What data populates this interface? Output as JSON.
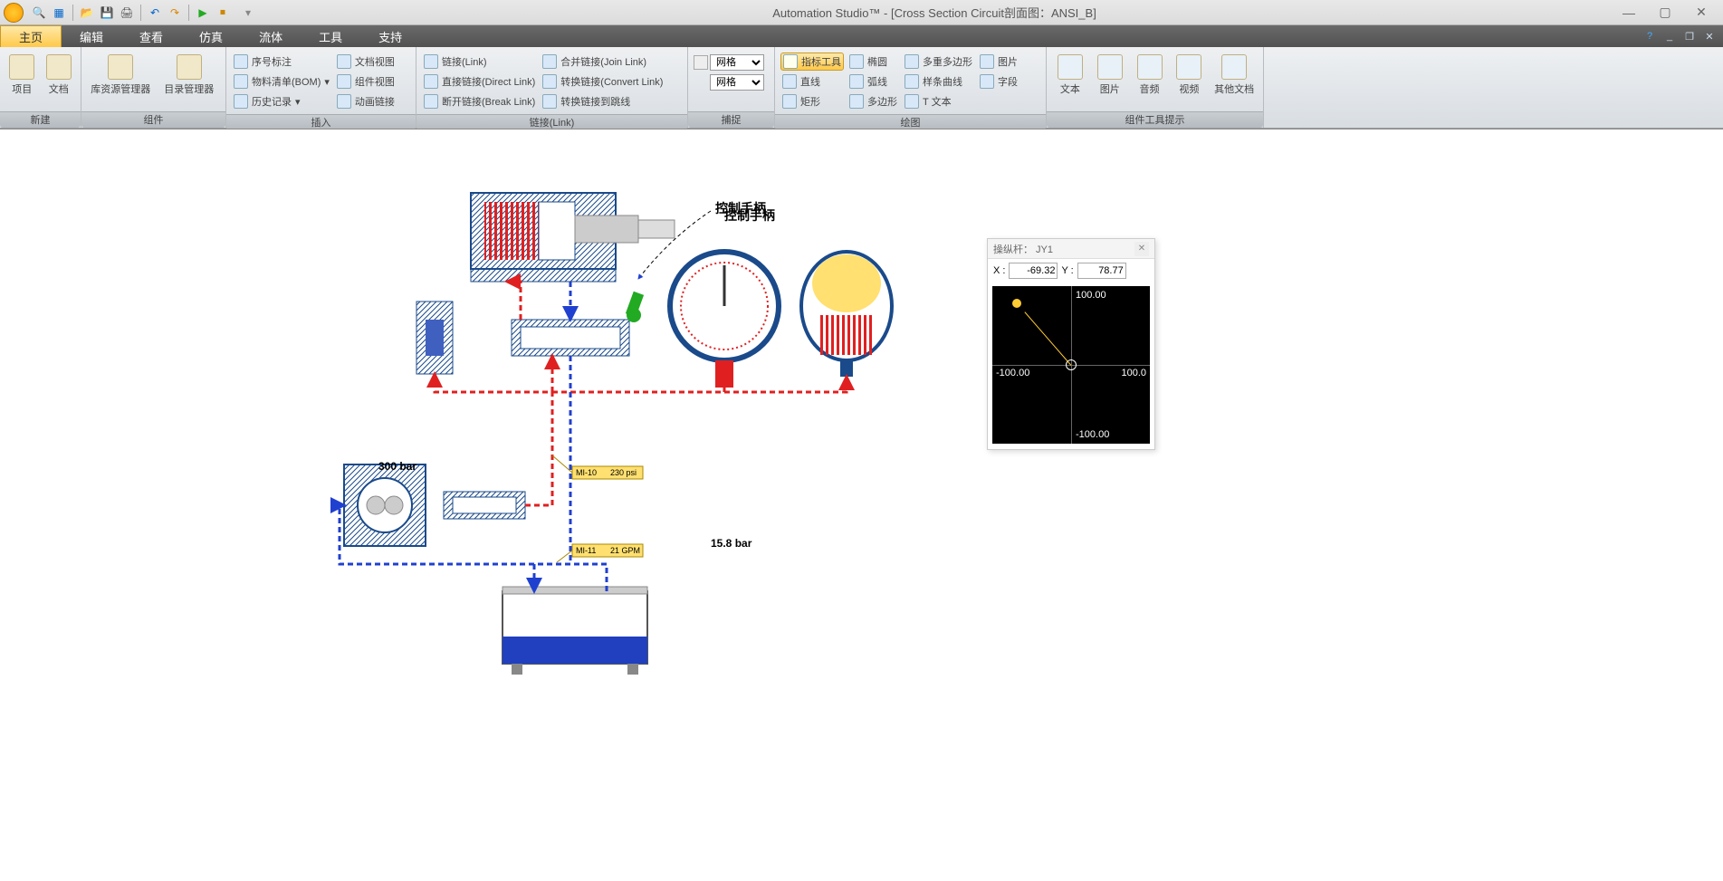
{
  "app": {
    "title": "Automation Studio™ - [Cross Section   Circuit剖面图：ANSI_B]"
  },
  "menu": {
    "tabs": [
      "主页",
      "编辑",
      "查看",
      "仿真",
      "流体",
      "工具",
      "支持"
    ]
  },
  "ribbon": {
    "groups": {
      "new": {
        "title": "新建",
        "project": "项目",
        "document": "文档"
      },
      "component": {
        "title": "组件",
        "libmgr": "库资源管理器",
        "catmgr": "目录管理器"
      },
      "insert": {
        "title": "插入",
        "seq": "序号标注",
        "bom": "物料清单(BOM)",
        "hist": "历史记录",
        "docview": "文档视图",
        "compview": "组件视图",
        "animlink": "动画链接"
      },
      "link": {
        "title": "链接(Link)",
        "link": "链接(Link)",
        "direct": "直接链接(Direct Link)",
        "break": "断开链接(Break Link)",
        "join": "合并链接(Join Link)",
        "convert": "转换链接(Convert Link)",
        "tojump": "转换链接到跳线"
      },
      "snap": {
        "title": "捕捉",
        "opt1": "网格",
        "opt2": "网格"
      },
      "draw": {
        "title": "绘图",
        "pointer": "指标工具",
        "line": "直线",
        "rect": "矩形",
        "ellipse": "椭圆",
        "arc": "弧线",
        "polygon": "多边形",
        "polypoly": "多重多边形",
        "spline": "样条曲线",
        "text": "T 文本",
        "image": "图片",
        "field": "字段"
      },
      "hint": {
        "title": "组件工具提示",
        "text": "文本",
        "image": "图片",
        "audio": "音频",
        "video": "视频",
        "other": "其他文档"
      }
    }
  },
  "diagram": {
    "label_control": "控制手柄",
    "pressure_300": "300 bar",
    "pressure_158": "15.8 bar",
    "meter1": {
      "id": "MI-10",
      "val": "230 psi"
    },
    "meter2": {
      "id": "MI-11",
      "val": "21 GPM"
    }
  },
  "joystick": {
    "title": "操纵杆： JY1",
    "xlabel": "X :",
    "ylabel": "Y :",
    "x": "-69.32",
    "y": "78.77",
    "top": "100.00",
    "bottom": "-100.00",
    "left": "-100.00",
    "right": "100.0"
  }
}
